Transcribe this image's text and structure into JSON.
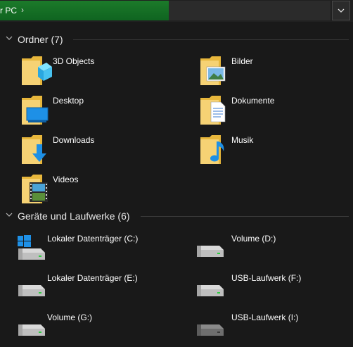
{
  "address_bar": {
    "path_text": "r PC",
    "progress_fraction": 0.51
  },
  "groups": {
    "folders": {
      "title": "Ordner (7)",
      "items": [
        {
          "label": "3D Objects",
          "icon": "3d-objects-folder-icon"
        },
        {
          "label": "Bilder",
          "icon": "pictures-folder-icon"
        },
        {
          "label": "Desktop",
          "icon": "desktop-folder-icon"
        },
        {
          "label": "Dokumente",
          "icon": "documents-folder-icon"
        },
        {
          "label": "Downloads",
          "icon": "downloads-folder-icon"
        },
        {
          "label": "Musik",
          "icon": "music-folder-icon"
        },
        {
          "label": "Videos",
          "icon": "videos-folder-icon"
        }
      ]
    },
    "drives": {
      "title": "Geräte und Laufwerke (6)",
      "items": [
        {
          "label": "Lokaler Datenträger (C:)",
          "icon": "windows-drive-icon"
        },
        {
          "label": "Volume (D:)",
          "icon": "hard-drive-icon"
        },
        {
          "label": "Lokaler Datenträger (E:)",
          "icon": "hard-drive-icon"
        },
        {
          "label": "USB-Laufwerk (F:)",
          "icon": "usb-drive-icon"
        },
        {
          "label": "Volume (G:)",
          "icon": "hard-drive-icon"
        },
        {
          "label": "USB-Laufwerk (I:)",
          "icon": "usb-drive-icon"
        }
      ]
    }
  },
  "colors": {
    "background": "#191919",
    "progress_green": "#157a28",
    "folder_yellow": "#f2c94c",
    "accent_blue": "#1e90e6"
  }
}
